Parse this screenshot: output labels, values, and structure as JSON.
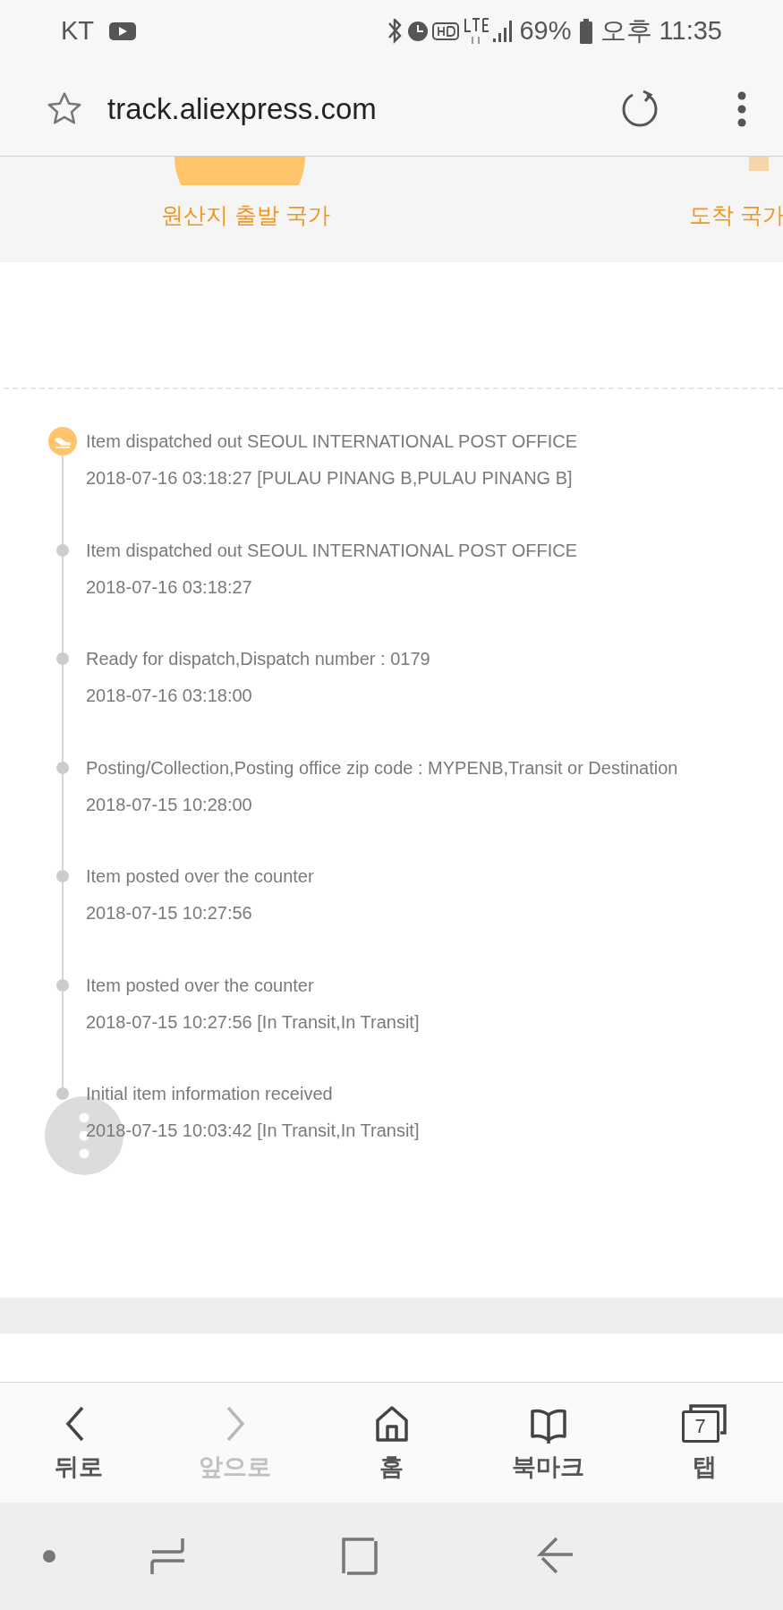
{
  "status_bar": {
    "carrier": "KT",
    "battery": "69%",
    "time": "오후 11:35"
  },
  "address_bar": {
    "url": "track.aliexpress.com"
  },
  "route": {
    "origin": "원산지 출발 국가",
    "destination": "도착 국가"
  },
  "events": [
    {
      "title": "Item dispatched out SEOUL INTERNATIONAL POST OFFICE",
      "detail": "2018-07-16 03:18:27 [PULAU PINANG B,PULAU PINANG B]",
      "current": true
    },
    {
      "title": "Item dispatched out SEOUL INTERNATIONAL POST OFFICE",
      "detail": "2018-07-16 03:18:27",
      "current": false
    },
    {
      "title": "Ready for dispatch,Dispatch number : 0179",
      "detail": "2018-07-16 03:18:00",
      "current": false
    },
    {
      "title": "Posting/Collection,Posting office zip code : MYPENB,Transit or Destination",
      "detail": "2018-07-15 10:28:00",
      "current": false
    },
    {
      "title": "Item posted over the counter",
      "detail": "2018-07-15 10:27:56",
      "current": false
    },
    {
      "title": "Item posted over the counter",
      "detail": "2018-07-15 10:27:56 [In Transit,In Transit]",
      "current": false
    },
    {
      "title": "Initial item information received",
      "detail": "2018-07-15 10:03:42 [In Transit,In Transit]",
      "current": false
    }
  ],
  "bottom_nav": [
    {
      "kind": "back",
      "label": "뒤로",
      "disabled": false
    },
    {
      "kind": "forward",
      "label": "앞으로",
      "disabled": true
    },
    {
      "kind": "home",
      "label": "홈",
      "disabled": false
    },
    {
      "kind": "bookmarks",
      "label": "북마크",
      "disabled": false
    },
    {
      "kind": "tabs",
      "label": "탭",
      "disabled": false,
      "count": "7"
    }
  ]
}
